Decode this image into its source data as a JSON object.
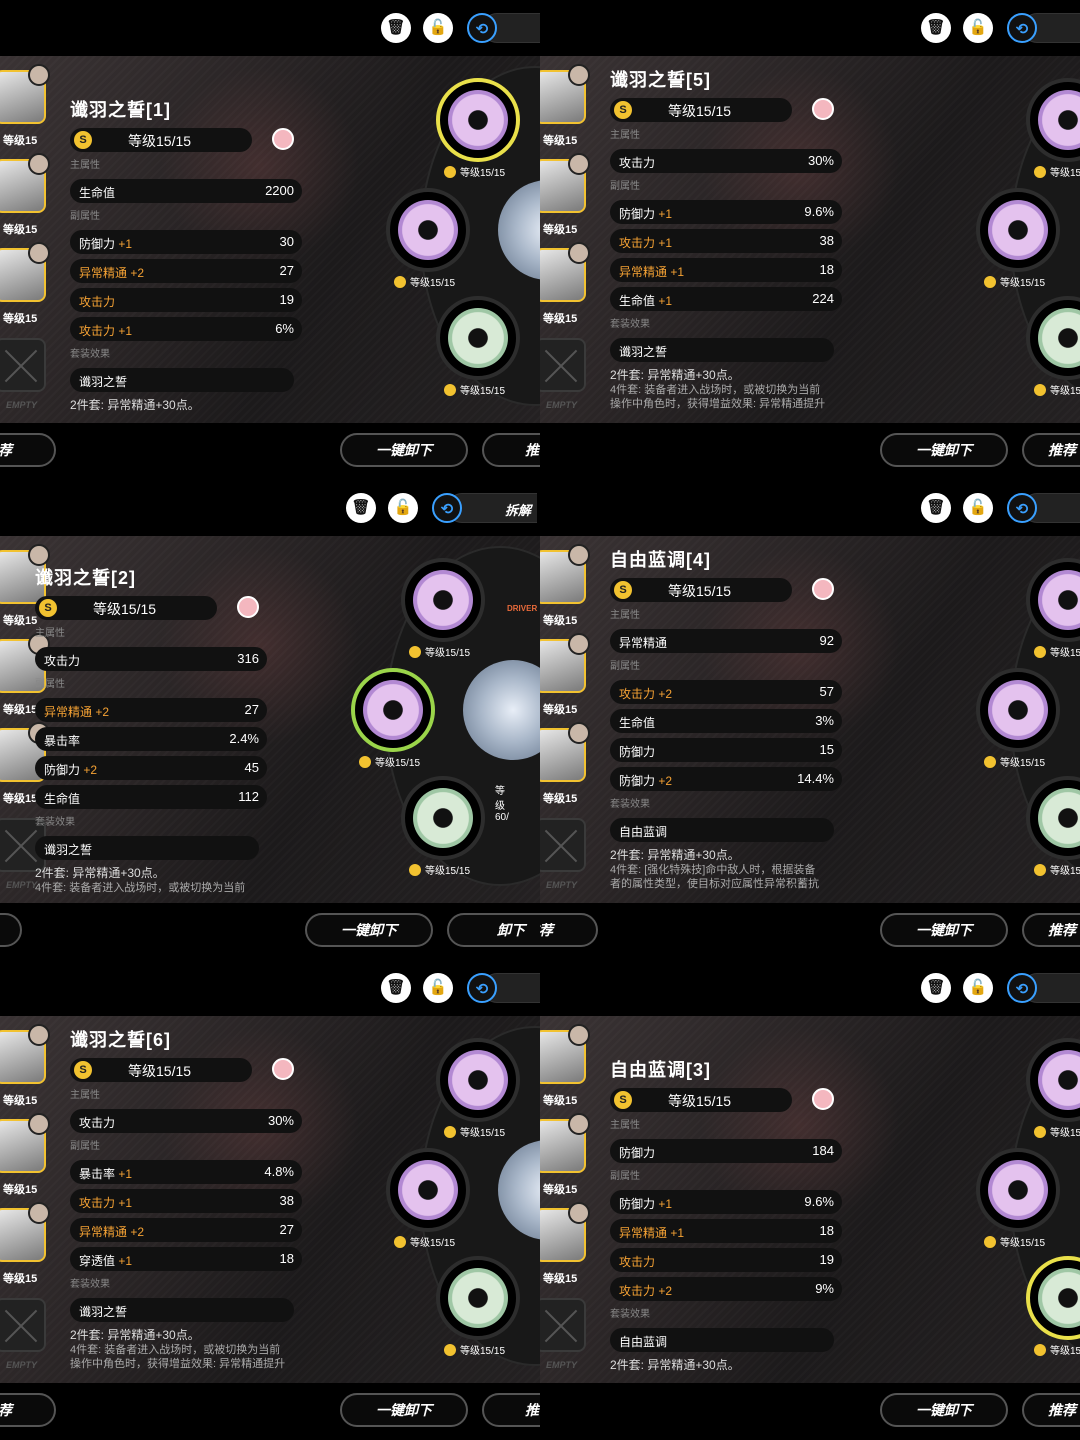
{
  "common": {
    "level": "等级15/15",
    "slot_level": "等级15",
    "disc_level": "等级15/15",
    "empty_label": "EMPTY",
    "main_attr": "主属性",
    "sub_attr": "副属性",
    "set_effect": "套装效果",
    "unequip_all": "一键卸下",
    "recommend": "推荐",
    "unequip": "卸下",
    "dismantle": "拆解",
    "driver_label": "DRIVER",
    "engine_level": "等级60/",
    "coin": "S",
    "trash": "🗑",
    "lock": "🔓",
    "swap": "⟲"
  },
  "panels": [
    {
      "title": "谶羽之誓[1]",
      "main": {
        "name": "生命值",
        "value": "2200"
      },
      "subs": [
        {
          "name": "防御力",
          "plus": "+1",
          "value": "30",
          "hl": false
        },
        {
          "name": "异常精通",
          "plus": "+2",
          "value": "27",
          "hl": true
        },
        {
          "name": "攻击力",
          "plus": "",
          "value": "19",
          "hl": true
        },
        {
          "name": "攻击力",
          "plus": "+1",
          "value": "6%",
          "hl": true
        }
      ],
      "set_name": "谶羽之誓",
      "desc_lines": [
        "2件套: 异常精通+30点。"
      ]
    },
    {
      "title": "谶羽之誓[5]",
      "main": {
        "name": "攻击力",
        "value": "30%"
      },
      "subs": [
        {
          "name": "防御力",
          "plus": "+1",
          "value": "9.6%",
          "hl": false
        },
        {
          "name": "攻击力",
          "plus": "+1",
          "value": "38",
          "hl": true
        },
        {
          "name": "异常精通",
          "plus": "+1",
          "value": "18",
          "hl": true
        },
        {
          "name": "生命值",
          "plus": "+1",
          "value": "224",
          "hl": false
        }
      ],
      "set_name": "谶羽之誓",
      "desc_lines": [
        "2件套: 异常精通+30点。",
        "4件套: 装备者进入战场时，或被切换为当前",
        "操作中角色时，获得增益效果: 异常精通提升"
      ]
    },
    {
      "title": "谶羽之誓[2]",
      "main": {
        "name": "攻击力",
        "value": "316"
      },
      "subs": [
        {
          "name": "异常精通",
          "plus": "+2",
          "value": "27",
          "hl": true
        },
        {
          "name": "暴击率",
          "plus": "",
          "value": "2.4%",
          "hl": false
        },
        {
          "name": "防御力",
          "plus": "+2",
          "value": "45",
          "hl": false
        },
        {
          "name": "生命值",
          "plus": "",
          "value": "112",
          "hl": false
        }
      ],
      "set_name": "谶羽之誓",
      "desc_lines": [
        "2件套: 异常精通+30点。",
        "4件套: 装备者进入战场时，或被切换为当前"
      ]
    },
    {
      "title": "自由蓝调[4]",
      "main": {
        "name": "异常精通",
        "value": "92"
      },
      "subs": [
        {
          "name": "攻击力",
          "plus": "+2",
          "value": "57",
          "hl": true
        },
        {
          "name": "生命值",
          "plus": "",
          "value": "3%",
          "hl": false
        },
        {
          "name": "防御力",
          "plus": "",
          "value": "15",
          "hl": false
        },
        {
          "name": "防御力",
          "plus": "+2",
          "value": "14.4%",
          "hl": false
        }
      ],
      "set_name": "自由蓝调",
      "desc_lines": [
        "2件套: 异常精通+30点。",
        "4件套: [强化特殊技]命中敌人时，根据装备",
        "者的属性类型，使目标对应属性异常积蓄抗"
      ]
    },
    {
      "title": "谶羽之誓[6]",
      "main": {
        "name": "攻击力",
        "value": "30%"
      },
      "subs": [
        {
          "name": "暴击率",
          "plus": "+1",
          "value": "4.8%",
          "hl": false
        },
        {
          "name": "攻击力",
          "plus": "+1",
          "value": "38",
          "hl": true
        },
        {
          "name": "异常精通",
          "plus": "+2",
          "value": "27",
          "hl": true
        },
        {
          "name": "穿透值",
          "plus": "+1",
          "value": "18",
          "hl": false
        }
      ],
      "set_name": "谶羽之誓",
      "desc_lines": [
        "2件套: 异常精通+30点。",
        "4件套: 装备者进入战场时，或被切换为当前",
        "操作中角色时，获得增益效果: 异常精通提升"
      ]
    },
    {
      "title": "自由蓝调[3]",
      "main": {
        "name": "防御力",
        "value": "184"
      },
      "subs": [
        {
          "name": "防御力",
          "plus": "+1",
          "value": "9.6%",
          "hl": false
        },
        {
          "name": "异常精通",
          "plus": "+1",
          "value": "18",
          "hl": true
        },
        {
          "name": "攻击力",
          "plus": "",
          "value": "19",
          "hl": true
        },
        {
          "name": "攻击力",
          "plus": "+2",
          "value": "9%",
          "hl": true
        }
      ],
      "set_name": "自由蓝调",
      "desc_lines": [
        "2件套: 异常精通+30点。"
      ]
    }
  ]
}
